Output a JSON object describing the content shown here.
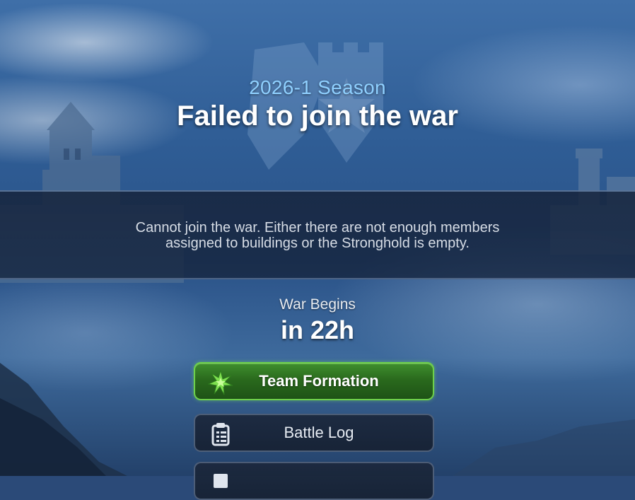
{
  "header": {
    "season": "2026-1 Season",
    "title": "Failed to join the war"
  },
  "notice": {
    "message_line1": "Cannot join the war. Either there are not enough members",
    "message_line2": "assigned to buildings or the Stronghold is empty."
  },
  "countdown": {
    "label": "War Begins",
    "value": "in 22h"
  },
  "buttons": {
    "team_formation": {
      "label": "Team Formation",
      "icon": "star-burst-icon"
    },
    "battle_log": {
      "label": "Battle Log",
      "icon": "clipboard-icon"
    },
    "third": {
      "label": "",
      "icon": "castle-icon"
    }
  },
  "colors": {
    "season_text": "#8fd0ff",
    "primary_button": "#2a6a1d",
    "primary_border": "#6ed04b",
    "secondary_button": "#1c283c"
  }
}
